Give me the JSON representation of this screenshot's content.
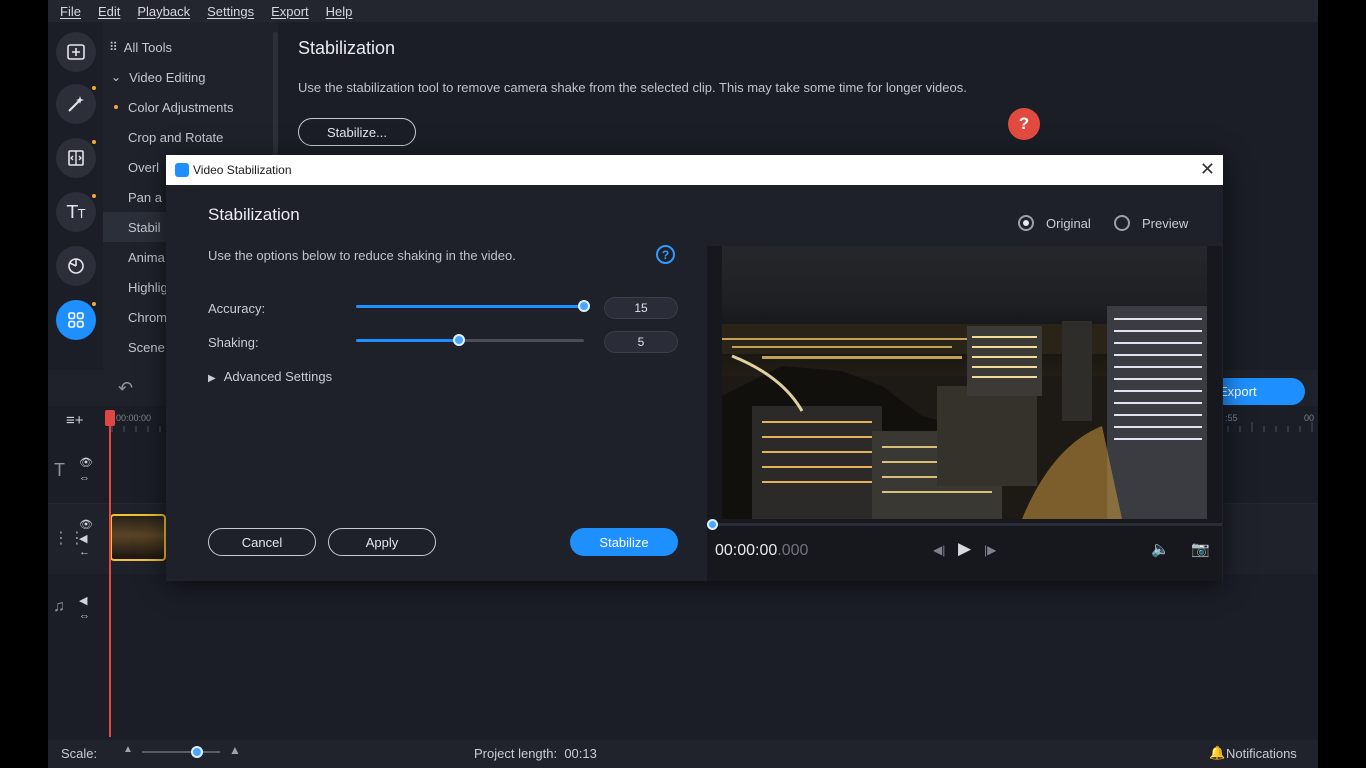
{
  "menu": [
    "File",
    "Edit",
    "Playback",
    "Settings",
    "Export",
    "Help"
  ],
  "toolnav": {
    "items": [
      {
        "label": "All Tools",
        "prefix": "grid"
      },
      {
        "label": "Video Editing",
        "prefix": "chevron"
      },
      {
        "label": "Color Adjustments",
        "prefix": "dot"
      },
      {
        "label": "Crop and Rotate",
        "prefix": ""
      },
      {
        "label": "Overl",
        "prefix": ""
      },
      {
        "label": "Pan a",
        "prefix": ""
      },
      {
        "label": "Stabil",
        "prefix": ""
      },
      {
        "label": "Anima",
        "prefix": ""
      },
      {
        "label": "Highlig",
        "prefix": ""
      },
      {
        "label": "Chrom",
        "prefix": ""
      },
      {
        "label": "Scene",
        "prefix": ""
      }
    ],
    "selected_index": 6
  },
  "rail_icons": [
    "import-icon",
    "magic-wand-icon",
    "transitions-icon",
    "titles-icon",
    "filters-icon",
    "more-tools-icon"
  ],
  "toolpanel": {
    "title": "Stabilization",
    "description": "Use the stabilization tool to remove camera shake from the selected clip. This may take some time for longer videos.",
    "button": "Stabilize..."
  },
  "timeline": {
    "export_label": "Export",
    "ruler_start": "00:00:00",
    "ruler_right": [
      ":55",
      "00"
    ]
  },
  "statusbar": {
    "scale_label": "Scale:",
    "scale_value": 0.7,
    "project_length": "Project length:  00:13",
    "notifications": "Notifications"
  },
  "dialog": {
    "window_title": "Video Stabilization",
    "heading": "Stabilization",
    "description": "Use the options below to reduce shaking in the video.",
    "accuracy_label": "Accuracy:",
    "accuracy_value": "15",
    "accuracy_fraction": 1.0,
    "shaking_label": "Shaking:",
    "shaking_value": "5",
    "shaking_fraction": 0.45,
    "advanced_label": "Advanced Settings",
    "cancel_label": "Cancel",
    "apply_label": "Apply",
    "stabilize_label": "Stabilize",
    "radio_original": "Original",
    "radio_preview": "Preview",
    "selected_view": "Original",
    "timecode_main": "00:00:00",
    "timecode_ms": ".000",
    "seek_fraction": 0.0
  },
  "colors": {
    "accent": "#1e8fff",
    "help": "#e04a3f",
    "clip_border": "#f2c232",
    "playhead": "#e04646"
  }
}
